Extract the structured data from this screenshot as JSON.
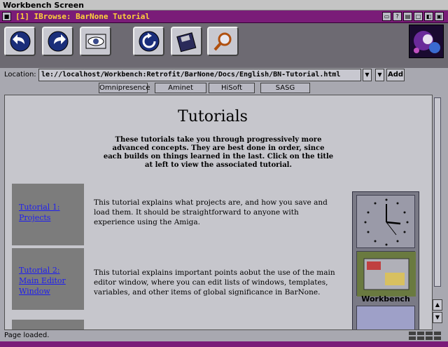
{
  "screen": {
    "title": "Workbench Screen"
  },
  "window": {
    "title": "[1] IBrowse: BarNone Tutorial"
  },
  "toolbar": {
    "buttons": [
      "back-icon",
      "forward-icon",
      "images-eye-icon",
      "reload-icon",
      "save-disk-icon",
      "search-magnifier-icon"
    ]
  },
  "location": {
    "label": "Location:",
    "url": "le://localhost/Workbench:Retrofit/BarNone/Docs/English/BN-Tutorial.html",
    "add_label": "Add"
  },
  "bookmarks": [
    "Omnipresence",
    "Aminet",
    "HiSoft",
    "SASG"
  ],
  "page": {
    "heading": "Tutorials",
    "intro": "These tutorials take you through progressively more advanced concepts. They are best done in order, since each builds on things learned in the last. Click on the title at left to view the associated tutorial.",
    "tutorials": [
      {
        "line1": "Tutorial 1:",
        "line2": "Projects",
        "line3": "",
        "desc": "This tutorial explains what projects are, and how you save and load them. It should be straightforward to anyone with experience using the Amiga."
      },
      {
        "line1": "Tutorial 2:",
        "line2": "Main Editor",
        "line3": "Window",
        "desc": "This tutorial explains important points aobut the use of the main editor window, where you can edit lists of windows, templates, variables, and other items of global significance in BarNone."
      }
    ]
  },
  "sidebar": {
    "workbench_label": "Workbench"
  },
  "status": {
    "text": "Page loaded."
  },
  "colors": {
    "titlebar": "#7a1c78",
    "title_text": "#ffd23a",
    "link": "#1e1ef0"
  }
}
